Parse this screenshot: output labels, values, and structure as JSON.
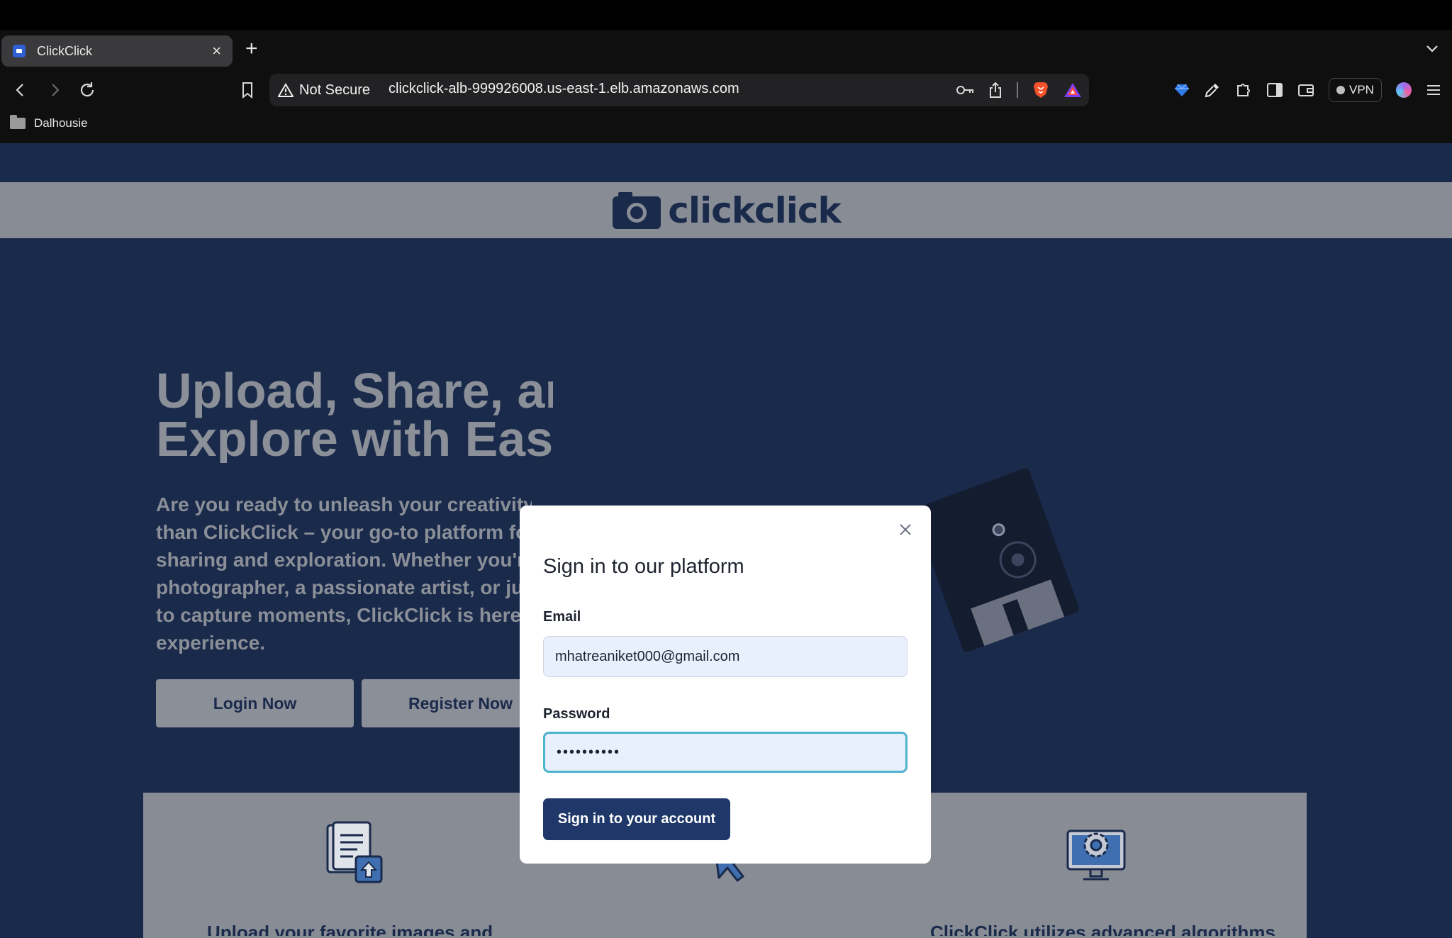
{
  "browser": {
    "tab": {
      "title": "ClickClick"
    },
    "new_tab_symbol": "+",
    "close_symbol": "×",
    "security_label": "Not Secure",
    "url": "clickclick-alb-999926008.us-east-1.elb.amazonaws.com",
    "vpn_label": "VPN",
    "bookmarks": [
      {
        "label": "Dalhousie"
      }
    ]
  },
  "site": {
    "brand": "clickclick",
    "hero": {
      "title_lines": [
        "Upload, Share, and",
        "Explore with Ease"
      ],
      "text_lines": [
        "Are you ready to unleash your creativity",
        "than ClickClick – your go-to platform for",
        "sharing and exploration. Whether you're",
        "photographer, a passionate artist, or just",
        "to capture moments, ClickClick is here to",
        "experience."
      ],
      "login_button": "Login Now",
      "register_button": "Register Now"
    },
    "features": [
      {
        "icon": "document-upload-icon",
        "caption": "Upload your favorite images and"
      },
      {
        "icon": "click-cursor-icon",
        "caption": ""
      },
      {
        "icon": "monitor-gear-icon",
        "caption": "ClickClick utilizes advanced algorithms"
      }
    ]
  },
  "modal": {
    "title": "Sign in to our platform",
    "email_label": "Email",
    "email_value": "mhatreaniket000@gmail.com",
    "password_label": "Password",
    "password_value": "••••••••••",
    "submit_label": "Sign in to your account"
  },
  "colors": {
    "page_bg": "#1a2a4b",
    "header_bg": "#888c95",
    "accent": "#1f3869",
    "focus_ring": "#4fb3cf"
  }
}
